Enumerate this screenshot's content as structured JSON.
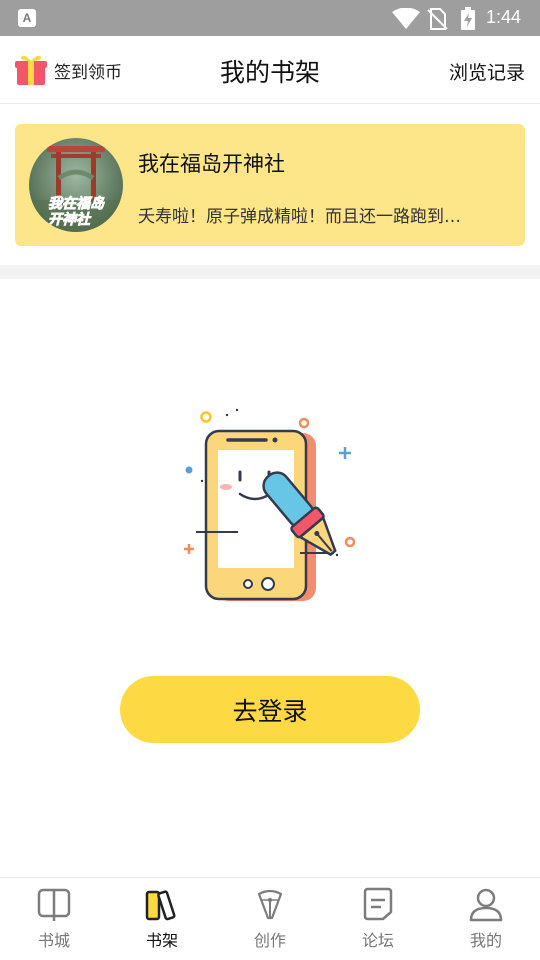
{
  "status_bar": {
    "time": "1:44",
    "notification_badge": "A",
    "icons": [
      "wifi-icon",
      "no-sim-icon",
      "battery-charging-icon"
    ]
  },
  "header": {
    "checkin_label": "签到领币",
    "title": "我的书架",
    "history_label": "浏览记录"
  },
  "banner": {
    "title": "我在福岛开神社",
    "description": "夭寿啦！原子弹成精啦！而且还一路跑到…",
    "cover_text_line1": "我在福岛",
    "cover_text_line2": "开神社"
  },
  "empty_state": {
    "illustration": "phone-with-pen-illustration"
  },
  "login_button_label": "去登录",
  "tabs": [
    {
      "label": "书城",
      "icon": "book-open-icon",
      "active": false
    },
    {
      "label": "书架",
      "icon": "bookshelf-icon",
      "active": true
    },
    {
      "label": "创作",
      "icon": "pen-nib-icon",
      "active": false
    },
    {
      "label": "论坛",
      "icon": "forum-note-icon",
      "active": false
    },
    {
      "label": "我的",
      "icon": "user-icon",
      "active": false
    }
  ],
  "colors": {
    "status_bar": "#9e9e9e",
    "banner_bg": "#fde58a",
    "primary_button": "#fdd943",
    "active_tab_accent": "#fdd943"
  }
}
